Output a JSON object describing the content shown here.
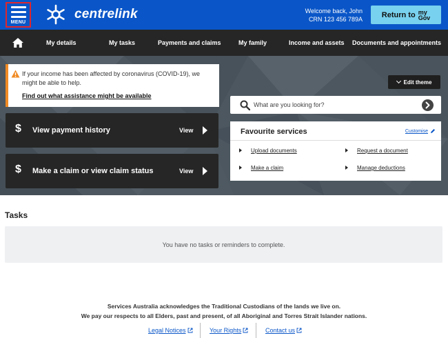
{
  "header": {
    "menu_label": "MENU",
    "logo_text": "centrelink",
    "welcome_line": "Welcome back, John",
    "crn_line": "CRN 123 456 789A",
    "return_label": "Return to",
    "mygov_top": "my",
    "mygov_bottom": "Gov"
  },
  "nav": {
    "items": [
      {
        "label": "My details"
      },
      {
        "label": "My tasks"
      },
      {
        "label": "Payments and claims"
      },
      {
        "label": "My family"
      },
      {
        "label": "Income and assets"
      },
      {
        "label": "Documents and appointments"
      }
    ]
  },
  "covid_notice": {
    "text": "If your income has been affected by coronavirus (COVID-19), we might be able to help.",
    "link": "Find out what assistance might be available",
    "accent": "#f08a24"
  },
  "actions": [
    {
      "icon": "dollar-icon",
      "title": "View payment history",
      "view": "View"
    },
    {
      "icon": "dollar-icon",
      "title": "Make a claim or view claim status",
      "view": "View"
    }
  ],
  "edit_theme": "Edit theme",
  "search": {
    "placeholder": "What are you looking for?"
  },
  "favourites": {
    "title": "Favourite services",
    "customise": "Customise",
    "items": [
      {
        "label": "Upload documents"
      },
      {
        "label": "Request a document"
      },
      {
        "label": "Make a claim"
      },
      {
        "label": "Manage deductions"
      }
    ]
  },
  "tasks": {
    "heading": "Tasks",
    "empty_message": "You have no tasks or reminders to complete."
  },
  "footer": {
    "ack_line1": "Services Australia acknowledges the Traditional Custodians of the lands we live on.",
    "ack_line2": "We pay our respects to all Elders, past and present, of all Aboriginal and Torres Strait Islander nations.",
    "links": [
      {
        "label": "Legal Notices"
      },
      {
        "label": "Your Rights"
      },
      {
        "label": "Contact us"
      }
    ]
  },
  "colors": {
    "brand_blue": "#0a56c8",
    "nav_dark": "#262626",
    "mygov_button": "#78d1ee",
    "menu_outline": "#e0262c"
  }
}
